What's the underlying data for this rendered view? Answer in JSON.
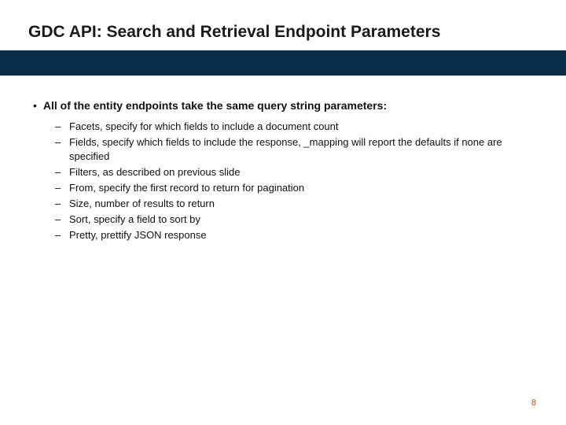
{
  "title": "GDC API: Search and Retrieval Endpoint Parameters",
  "bullet": {
    "text": "All of the entity endpoints take the same query string parameters:",
    "sub": [
      "Facets, specify for which fields to include a document count",
      "Fields, specify which fields to include the response, _mapping will report the defaults if none are specified",
      "Filters, as described on previous slide",
      "From, specify the first record to return for pagination",
      "Size, number of results to return",
      "Sort, specify a field to sort by",
      "Pretty, prettify JSON response"
    ]
  },
  "page_number": "8",
  "colors": {
    "bar": "#0b2e4a",
    "pagenum": "#b04a2a"
  }
}
